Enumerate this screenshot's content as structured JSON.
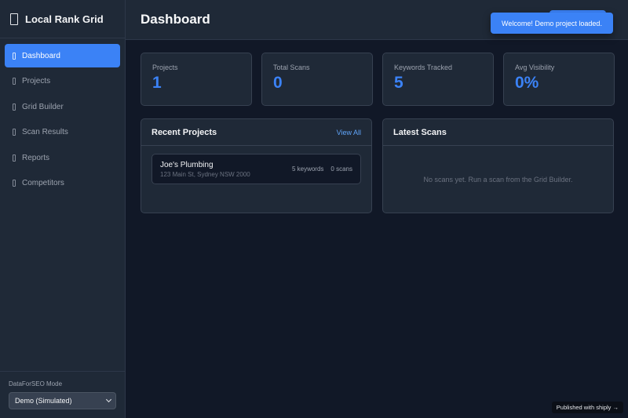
{
  "app": {
    "title": "Local Rank Grid",
    "brand_icon": "map-pin-icon"
  },
  "sidebar": {
    "items": [
      {
        "label": "Dashboard",
        "icon": "dashboard-icon",
        "active": true
      },
      {
        "label": "Projects",
        "icon": "folder-icon",
        "active": false
      },
      {
        "label": "Grid Builder",
        "icon": "grid-icon",
        "active": false
      },
      {
        "label": "Scan Results",
        "icon": "chart-icon",
        "active": false
      },
      {
        "label": "Reports",
        "icon": "report-icon",
        "active": false
      },
      {
        "label": "Competitors",
        "icon": "users-icon",
        "active": false
      }
    ],
    "mode_label": "DataForSEO Mode",
    "mode_value": "Demo (Simulated)"
  },
  "header": {
    "title": "Dashboard"
  },
  "stats": [
    {
      "label": "Projects",
      "value": "1"
    },
    {
      "label": "Total Scans",
      "value": "0"
    },
    {
      "label": "Keywords Tracked",
      "value": "5"
    },
    {
      "label": "Avg Visibility",
      "value": "0%"
    }
  ],
  "recent_projects": {
    "title": "Recent Projects",
    "view_all": "View All",
    "items": [
      {
        "name": "Joe's Plumbing",
        "address": "123 Main St, Sydney NSW 2000",
        "keywords": "5 keywords",
        "scans": "0 scans"
      }
    ]
  },
  "latest_scans": {
    "title": "Latest Scans",
    "empty_message": "No scans yet. Run a scan from the Grid Builder."
  },
  "toast": {
    "message": "Welcome! Demo project loaded."
  },
  "footer_badge": "Published with shiply →",
  "colors": {
    "accent": "#3b82f6",
    "background": "#111827",
    "surface": "#1f2937"
  }
}
